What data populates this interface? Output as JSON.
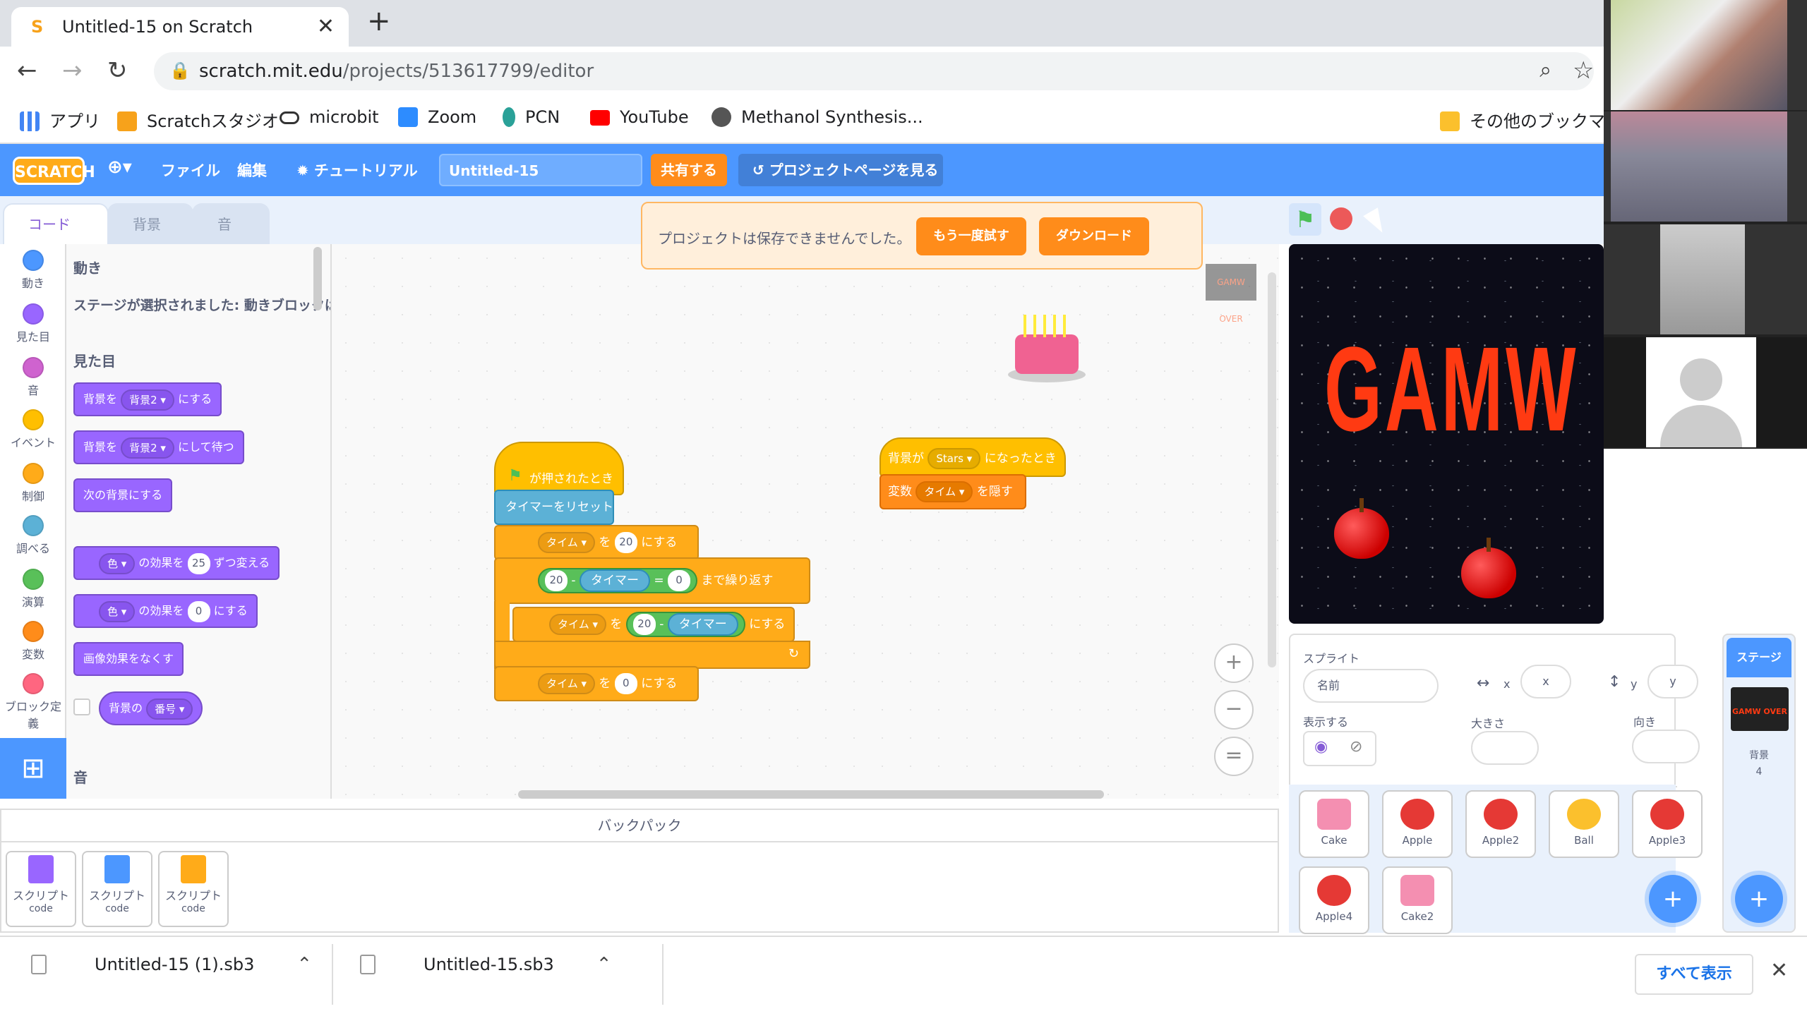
{
  "browser": {
    "tab_title": "Untitled-15 on Scratch",
    "tab_close": "✕",
    "new_tab": "+",
    "url_host": "scratch.mit.edu",
    "url_path": "/projects/513617799/editor",
    "bookmarks": [
      {
        "label": "アプリ",
        "color": "#4285f4"
      },
      {
        "label": "Scratchスタジオ",
        "color": "#f7a21b"
      },
      {
        "label": "microbit",
        "color": "#333333"
      },
      {
        "label": "Zoom",
        "color": "#2d8cff"
      },
      {
        "label": "PCN",
        "color": "#2aa198"
      },
      {
        "label": "YouTube",
        "color": "#ff0000"
      },
      {
        "label": "Methanol Synthesis...",
        "color": "#555555"
      }
    ],
    "other_bookmarks": "その他のブックマーク"
  },
  "menubar": {
    "logo": "SCRATCH",
    "language_icon": "globe-icon",
    "file": "ファイル",
    "edit": "編集",
    "tutorials": "チュートリアル",
    "project_title": "Untitled-15",
    "share": "共有する",
    "see_project_page": "プロジェクトページを見る"
  },
  "editor_tabs": {
    "code": "コード",
    "backdrops": "背景",
    "sounds": "音"
  },
  "alert": {
    "message": "プロジェクトは保存できませんでした。",
    "retry": "もう一度試す",
    "download": "ダウンロード"
  },
  "categories": [
    {
      "label": "動き",
      "color": "#4c97ff"
    },
    {
      "label": "見た目",
      "color": "#9966ff"
    },
    {
      "label": "音",
      "color": "#cf63cf"
    },
    {
      "label": "イベント",
      "color": "#ffbf00"
    },
    {
      "label": "制御",
      "color": "#ffab19"
    },
    {
      "label": "調べる",
      "color": "#5cb1d6"
    },
    {
      "label": "演算",
      "color": "#59c059"
    },
    {
      "label": "変数",
      "color": "#ff8c1a"
    },
    {
      "label": "ブロック定義",
      "color": "#ff6680"
    }
  ],
  "flyout": {
    "motion_heading": "動き",
    "motion_note": "ステージが選択されました: 動きブロックは",
    "looks_heading": "見た目",
    "b1_pre": "背景を",
    "b1_dd": "背景2",
    "b1_post": "にする",
    "b2_pre": "背景を",
    "b2_dd": "背景2",
    "b2_post": "にして待つ",
    "b3": "次の背景にする",
    "b4_dd": "色",
    "b4_mid": "の効果を",
    "b4_num": "25",
    "b4_post": "ずつ変える",
    "b5_dd": "色",
    "b5_mid": "の効果を",
    "b5_num": "0",
    "b5_post": "にする",
    "b6": "画像効果をなくす",
    "b7_pre": "背景の",
    "b7_dd": "番号",
    "sound_heading": "音"
  },
  "script1": {
    "hat": "が押されたとき",
    "reset": "タイマーをリセット",
    "set1_var": "タイム",
    "set1_to": "を",
    "set1_val": "20",
    "set1_post": "にする",
    "repeat_a": "20",
    "repeat_minus": "-",
    "repeat_timer": "タイマー",
    "repeat_eq": "=",
    "repeat_b": "0",
    "repeat_post": "まで繰り返す",
    "set2_var": "タイム",
    "set2_to": "を",
    "set2_val": "20",
    "set2_minus": "-",
    "set2_timer": "タイマー",
    "set2_post": "にする",
    "set3_var": "タイム",
    "set3_to": "を",
    "set3_val": "0",
    "set3_post": "にする"
  },
  "script2": {
    "hat_pre": "背景が",
    "hat_dd": "Stars",
    "hat_post": "になったとき",
    "hide_pre": "変数",
    "hide_dd": "タイム",
    "hide_post": "を隠す"
  },
  "stage": {
    "text": "GAMW OVER"
  },
  "sprite_info": {
    "sprite_label": "スプライト",
    "name_placeholder": "名前",
    "x_label": "x",
    "x_placeholder": "x",
    "y_label": "y",
    "y_placeholder": "y",
    "show_label": "表示する",
    "size_label": "大きさ",
    "direction_label": "向き"
  },
  "sprites": [
    {
      "name": "Cake",
      "color": "#f48fb1"
    },
    {
      "name": "Apple",
      "color": "#e53935"
    },
    {
      "name": "Apple2",
      "color": "#e53935"
    },
    {
      "name": "Ball",
      "color": "#fbc02d"
    },
    {
      "name": "Apple3",
      "color": "#e53935"
    },
    {
      "name": "Apple4",
      "color": "#e53935"
    },
    {
      "name": "Cake2",
      "color": "#f48fb1"
    }
  ],
  "stage_pane": {
    "header": "ステージ",
    "thumb": "GAMW OVER",
    "backdrops_label": "背景",
    "backdrops_count": "4"
  },
  "backpack": {
    "header": "バックパック",
    "items": [
      {
        "label": "スクリプト",
        "sub": "code",
        "color": "#9966ff"
      },
      {
        "label": "スクリプト",
        "sub": "code",
        "color": "#4c97ff"
      },
      {
        "label": "スクリプト",
        "sub": "code",
        "color": "#ffab19"
      }
    ]
  },
  "downloads": {
    "file1": "Untitled-15 (1).sb3",
    "file2": "Untitled-15.sb3",
    "show_all": "すべて表示"
  }
}
